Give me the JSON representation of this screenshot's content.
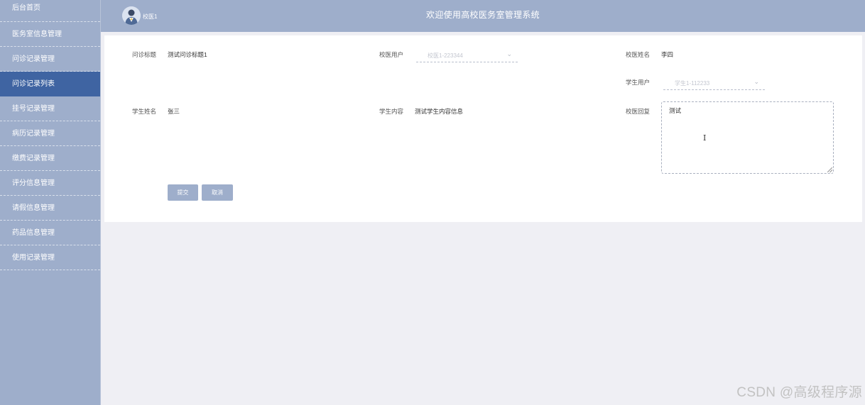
{
  "sidebar": {
    "items": [
      {
        "label": "后台首页"
      },
      {
        "label": "医务室信息管理"
      },
      {
        "label": "问诊记录管理"
      },
      {
        "label": "问诊记录列表"
      },
      {
        "label": "挂号记录管理"
      },
      {
        "label": "病历记录管理"
      },
      {
        "label": "缴费记录管理"
      },
      {
        "label": "评分信息管理"
      },
      {
        "label": "请假信息管理"
      },
      {
        "label": "药品信息管理"
      },
      {
        "label": "使用记录管理"
      }
    ],
    "active_index": 3
  },
  "header": {
    "user": "校医1",
    "title": "欢迎使用高校医务室管理系统"
  },
  "form": {
    "consult_title": {
      "label": "问诊标题",
      "value": "测试问诊标题1"
    },
    "doctor_user": {
      "label": "校医用户",
      "placeholder": "校医1-223344"
    },
    "doctor_name": {
      "label": "校医姓名",
      "value": "李四"
    },
    "student_user": {
      "label": "学生用户",
      "placeholder": "学生1-112233"
    },
    "student_name": {
      "label": "学生姓名",
      "value": "张三"
    },
    "student_content": {
      "label": "学生内容",
      "value": "测试学生内容信息"
    },
    "doctor_reply": {
      "label": "校医回复",
      "value": "测试"
    }
  },
  "buttons": {
    "submit": "提交",
    "cancel": "取消"
  },
  "watermark": "CSDN @高级程序源",
  "colors": {
    "sidebar": "#9eaecb",
    "active": "#3f64a2",
    "background": "#efeff4"
  }
}
